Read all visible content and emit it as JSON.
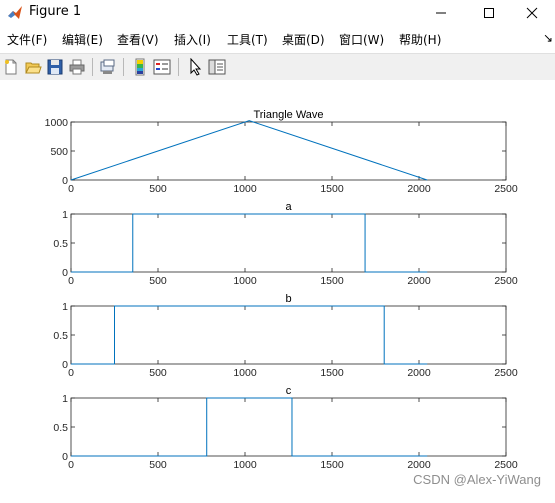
{
  "window": {
    "title": "Figure 1",
    "controls": {
      "minimize": "─",
      "maximize": "☐",
      "close": "✕"
    }
  },
  "menu": {
    "items": [
      "文件(F)",
      "编辑(E)",
      "查看(V)",
      "插入(I)",
      "工具(T)",
      "桌面(D)",
      "窗口(W)",
      "帮助(H)"
    ],
    "overflow": "↘"
  },
  "toolbar": {
    "icons": [
      "new-figure-icon",
      "open-file-icon",
      "save-icon",
      "print-icon",
      "print-preview-icon",
      "colorbar-icon",
      "legend-icon",
      "edit-plot-arrow-icon",
      "property-editor-icon"
    ]
  },
  "colors": {
    "line": "#0072bd",
    "axes": "#262626"
  },
  "chart_data": [
    {
      "type": "line",
      "title": "Triangle Wave",
      "xlim": [
        0,
        2500
      ],
      "ylim": [
        0,
        1000
      ],
      "xticks": [
        "0",
        "500",
        "1000",
        "1500",
        "2000",
        "2500"
      ],
      "yticks": [
        "0",
        "500",
        "1000"
      ],
      "x": [
        0,
        1024,
        2047
      ],
      "y": [
        0,
        1024,
        0
      ]
    },
    {
      "type": "line",
      "title": "a",
      "xlim": [
        0,
        2500
      ],
      "ylim": [
        0,
        1
      ],
      "xticks": [
        "0",
        "500",
        "1000",
        "1500",
        "2000",
        "2500"
      ],
      "yticks": [
        "0",
        "0.5",
        "1"
      ],
      "x": [
        0,
        355,
        355,
        1690,
        1690,
        2047
      ],
      "y": [
        0,
        0,
        1,
        1,
        0,
        0
      ]
    },
    {
      "type": "line",
      "title": "b",
      "xlim": [
        0,
        2500
      ],
      "ylim": [
        0,
        1
      ],
      "xticks": [
        "0",
        "500",
        "1000",
        "1500",
        "2000",
        "2500"
      ],
      "yticks": [
        "0",
        "0.5",
        "1"
      ],
      "x": [
        0,
        250,
        250,
        1800,
        1800,
        2047
      ],
      "y": [
        0,
        0,
        1,
        1,
        0,
        0
      ]
    },
    {
      "type": "line",
      "title": "c",
      "xlim": [
        0,
        2500
      ],
      "ylim": [
        0,
        1
      ],
      "xticks": [
        "0",
        "500",
        "1000",
        "1500",
        "2000",
        "2500"
      ],
      "yticks": [
        "0",
        "0.5",
        "1"
      ],
      "x": [
        0,
        780,
        780,
        1270,
        1270,
        2047
      ],
      "y": [
        0,
        0,
        1,
        1,
        0,
        0
      ]
    }
  ],
  "watermark": "CSDN @Alex-YiWang"
}
